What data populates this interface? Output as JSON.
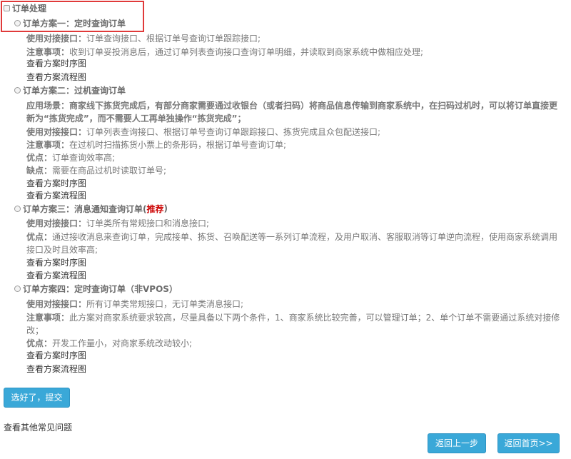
{
  "root": {
    "label": "订单处理"
  },
  "options": [
    {
      "title": "订单方案一：定时查询订单",
      "lines": [
        {
          "key": "使用对接接口：",
          "text": "订单查询接口、根据订单号查询订单跟踪接口;"
        },
        {
          "key": "注意事项：",
          "text": "收到订单妥投消息后，通过订单列表查询接口查询订单明细，并读取到商家系统中做相应处理;"
        }
      ],
      "links": [
        "查看方案时序图",
        "查看方案流程图"
      ]
    },
    {
      "title": "订单方案二：过机查询订单",
      "scenario": {
        "key": "应用场景：",
        "text": "商家线下拣货完成后，有部分商家需要通过收银台（或者扫码）将商品信息传输到商家系统中，在扫码过机时，可以将订单直接更新为“拣货完成”，而不需要人工再单独操作“拣货完成”；"
      },
      "lines": [
        {
          "key": "使用对接接口：",
          "text": "订单列表查询接口、根据订单号查询订单跟踪接口、拣货完成且众包配送接口;"
        },
        {
          "key": "注意事项：",
          "text": "在过机时扫描拣货小票上的条形码，根据订单号查询订单;"
        },
        {
          "key": "优点：",
          "text": "订单查询效率高;"
        },
        {
          "key": "缺点：",
          "text": "需要在商品过机时读取订单号;"
        }
      ],
      "links": [
        "查看方案时序图",
        "查看方案流程图"
      ]
    },
    {
      "title": "订单方案三：消息通知查询订单(",
      "recommend": "推荐",
      "title_end": ")",
      "lines": [
        {
          "key": "使用对接接口：",
          "text": "订单类所有常规接口和消息接口;"
        },
        {
          "key": "优点：",
          "text": "通过接收消息来查询订单，完成接单、拣货、召唤配送等一系列订单流程，及用户取消、客服取消等订单逆向流程，使用商家系统调用接口及时且效率高;"
        }
      ],
      "links": [
        "查看方案时序图",
        "查看方案流程图"
      ]
    },
    {
      "title": "订单方案四：定时查询订单（非VPOS）",
      "lines": [
        {
          "key": "使用对接接口：",
          "text": "所有订单类常规接口，无订单类消息接口;"
        },
        {
          "key": "注意事项：",
          "text": "此方案对商家系统要求较高，尽量具备以下两个条件，1、商家系统比较完善，可以管理订单；2、单个订单不需要通过系统对接修改；"
        },
        {
          "key": "优点：",
          "text": "开发工作量小，对商家系统改动较小;"
        }
      ],
      "links": [
        "查看方案时序图",
        "查看方案流程图"
      ]
    }
  ],
  "buttons": {
    "submit": "选好了，提交",
    "back": "返回上一步",
    "home": "返回首页>>"
  },
  "faq": "查看其他常见问题",
  "colors": {
    "highlight": "#e03a3a",
    "button": "#3aa8d8",
    "recommend": "#cc0000"
  }
}
